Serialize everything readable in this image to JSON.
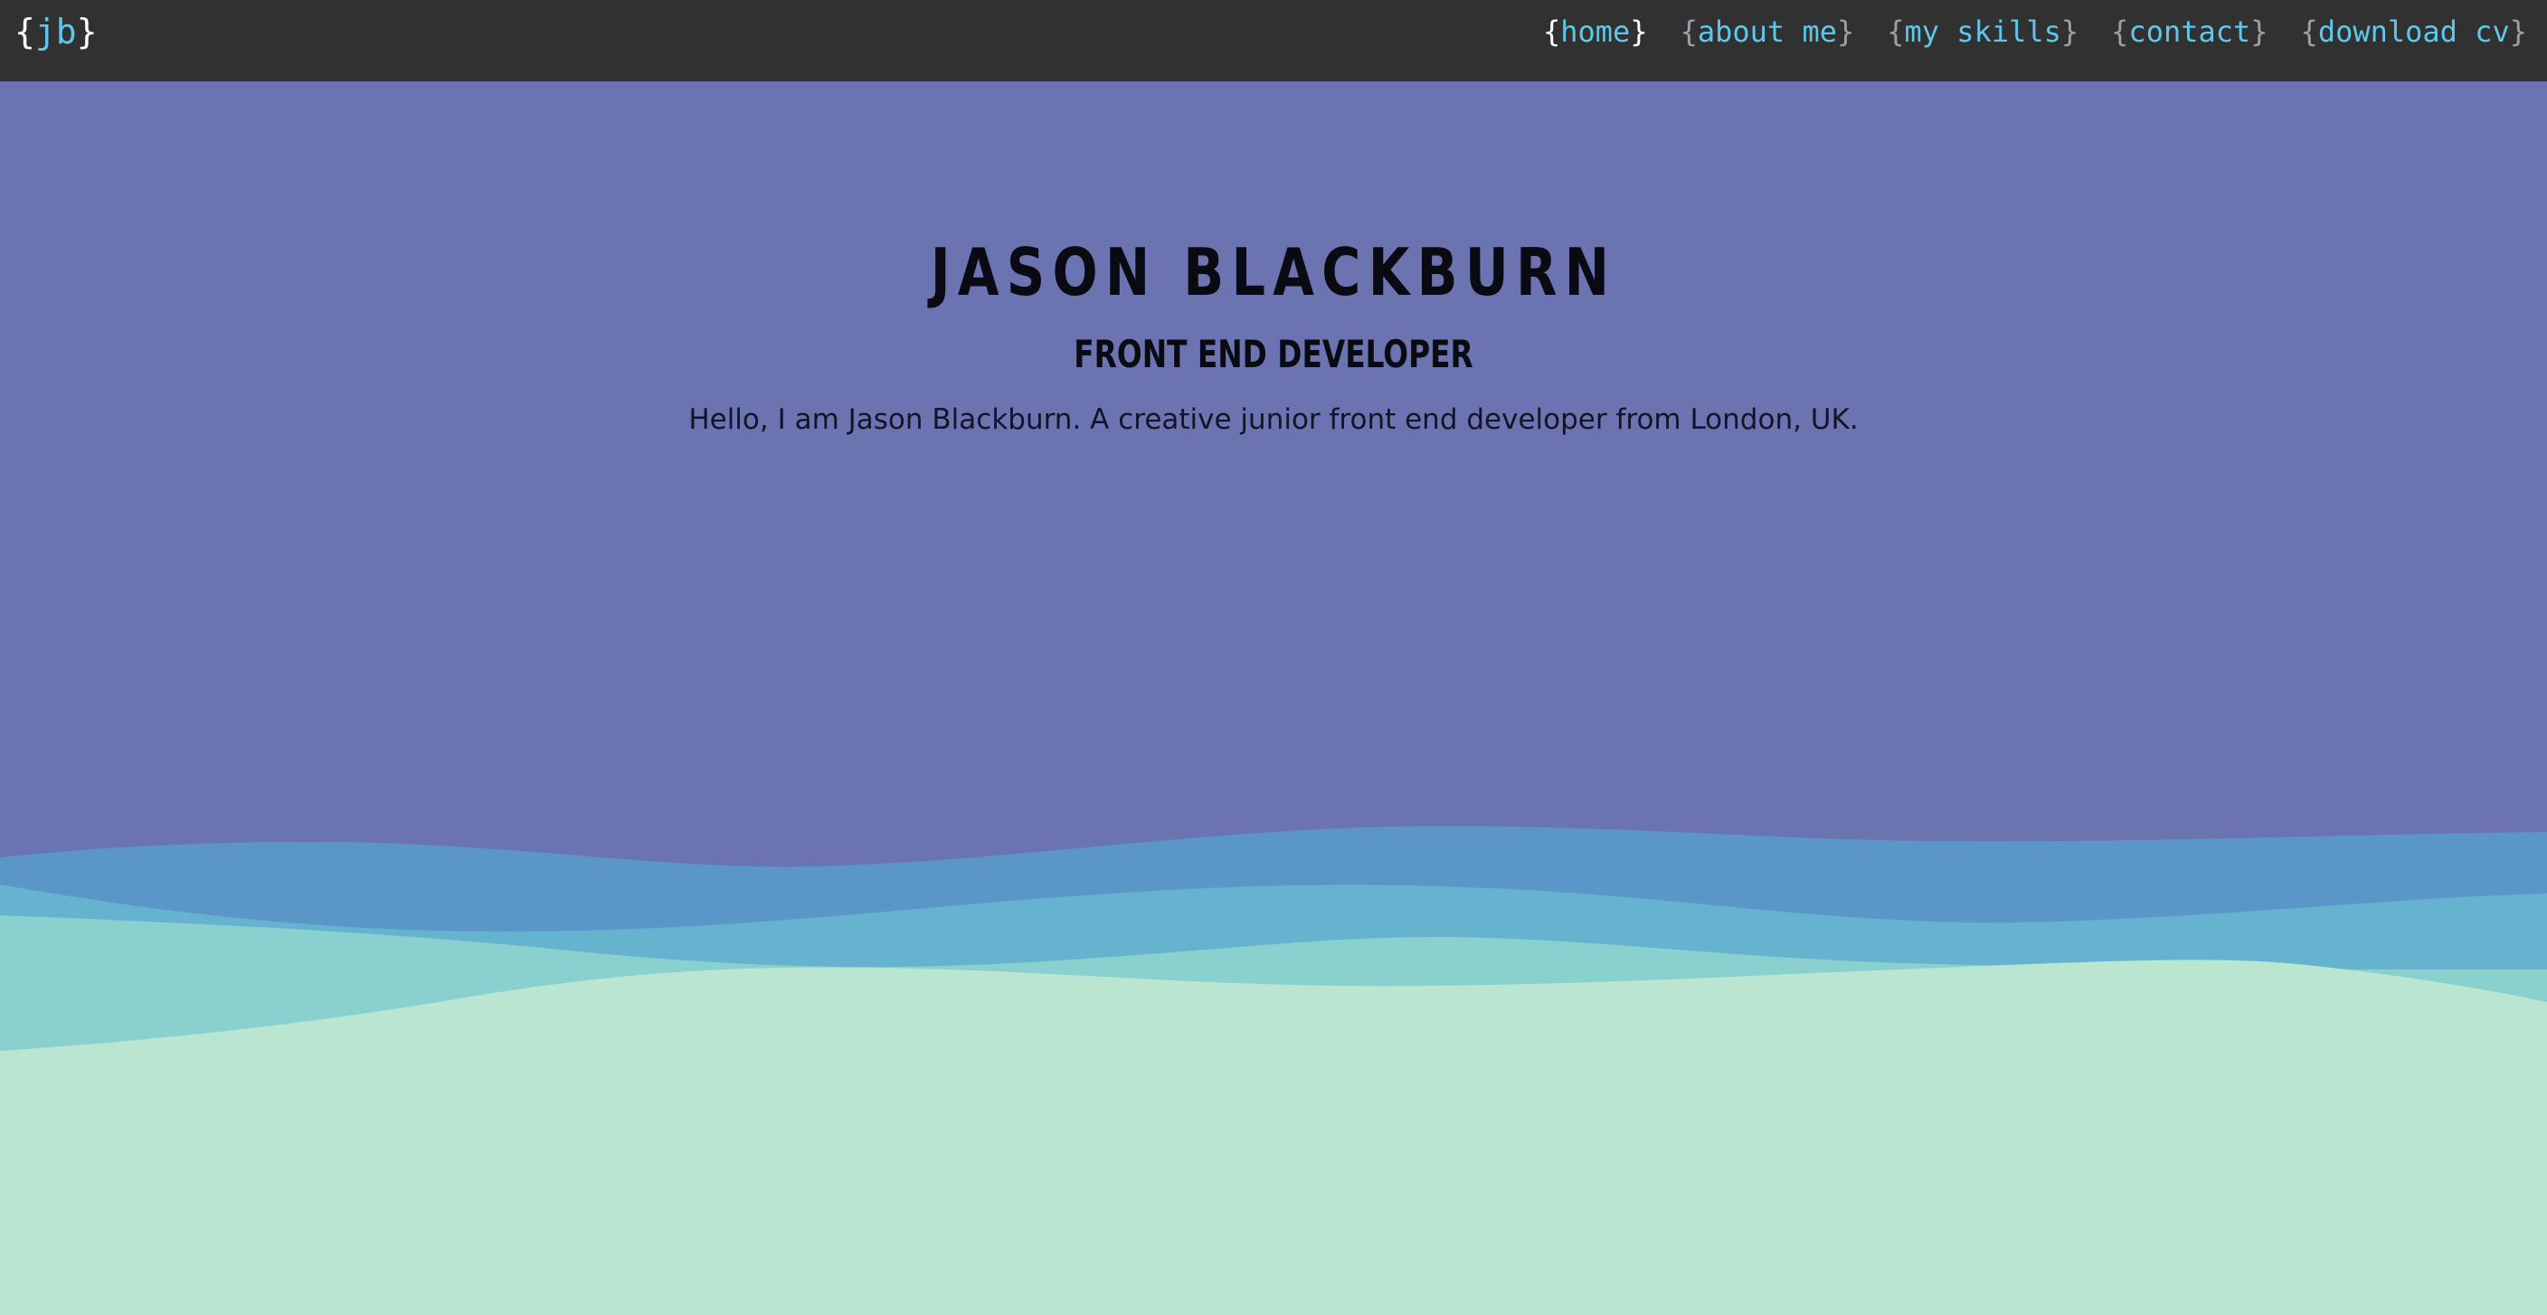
{
  "brand": {
    "open": "{",
    "text": "jb",
    "close": "}"
  },
  "nav": {
    "items": [
      {
        "open": "{",
        "label": "home",
        "close": "}",
        "active": true
      },
      {
        "open": "{",
        "label": "about me",
        "close": "}"
      },
      {
        "open": "{",
        "label": "my skills",
        "close": "}"
      },
      {
        "open": "{",
        "label": "contact",
        "close": "}"
      },
      {
        "open": "{",
        "label": "download cv",
        "close": "}"
      }
    ]
  },
  "hero": {
    "name": "JASON BLACKBURN",
    "role": "FRONT END DEVELOPER",
    "description": "Hello, I am Jason Blackburn. A creative junior front end developer from London, UK."
  },
  "colors": {
    "navbar_bg": "#313131",
    "hero_bg": "#6b73b0",
    "accent": "#5ec8ea",
    "wave_1": "#5b96c9",
    "wave_2": "#65b3cf",
    "wave_3": "#8ad0cf",
    "wave_4": "#bae6d1"
  }
}
